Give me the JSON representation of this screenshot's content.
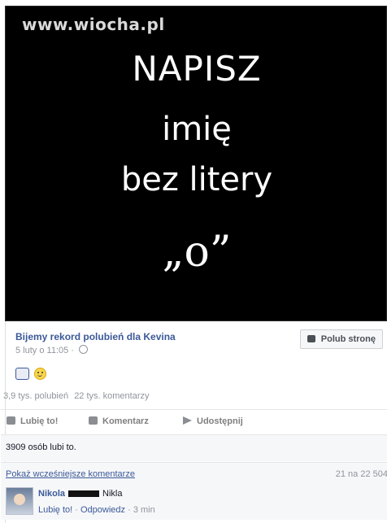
{
  "image_post": {
    "watermark": "www.wiocha.pl",
    "lines": [
      "NAPISZ",
      "imię",
      "bez litery",
      "„o”"
    ]
  },
  "post": {
    "page_name": "Bijemy rekord polubień dla Kevina",
    "date": "5 luty o 11:05 ·",
    "like_page_label": "Polub stronę",
    "likes": "3,9 tys. polubień",
    "comments": "22 tys. komentarzy",
    "actions": {
      "like": "Lubię to!",
      "comment": "Komentarz",
      "share": "Udostępnij"
    },
    "likes_summary": "3909 osób lubi to."
  },
  "comments": {
    "show_more": "Pokaż wcześniejsze komentarze",
    "count": "21 na 22 504",
    "first": {
      "author": "Nikola",
      "text": "Nikla",
      "like": "Lubię to!",
      "reply": "Odpowiedz",
      "time": "3 min"
    }
  }
}
